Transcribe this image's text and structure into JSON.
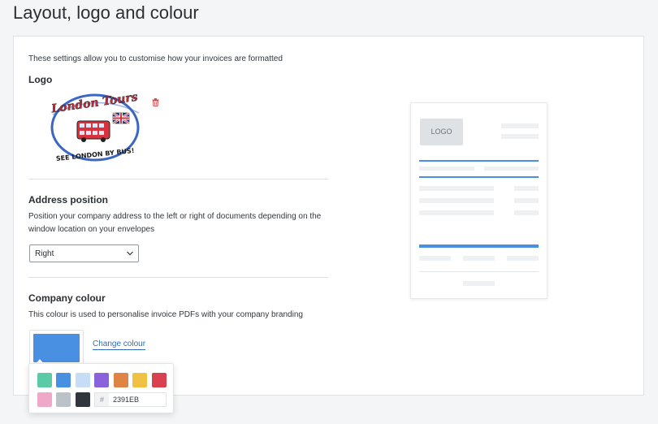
{
  "page": {
    "title": "Layout, logo and colour"
  },
  "settings": {
    "intro": "These settings allow you to customise how your invoices are formatted",
    "logo": {
      "heading": "Logo",
      "image_text": {
        "top": "London Tours",
        "bottom": "SEE LONDON BY BUS!"
      }
    },
    "address": {
      "heading": "Address position",
      "description": "Position your company address to the left or right of documents depending on the window location on your envelopes",
      "selected": "Right"
    },
    "colour": {
      "heading": "Company colour",
      "description": "This colour is used to personalise invoice PDFs with your company branding",
      "change_label": "Change colour",
      "current": "#4a90e2"
    }
  },
  "preview": {
    "logo_label": "LOGO"
  },
  "picker": {
    "swatches": [
      "#5cc9a7",
      "#4a90e2",
      "#c5ddf5",
      "#8a62dc",
      "#e08445",
      "#efc242",
      "#d9414f",
      "#f0a8c8",
      "#bcc3c8",
      "#31363c"
    ],
    "hex_prefix": "#",
    "hex_value": "2391EB"
  }
}
